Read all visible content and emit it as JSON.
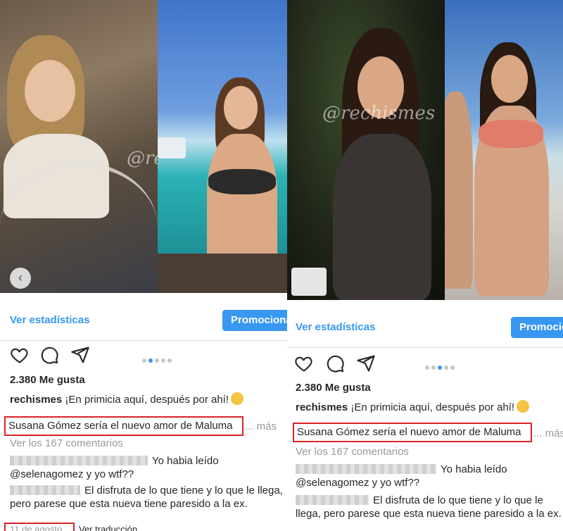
{
  "posts": [
    {
      "stats_link": "Ver estadísticas",
      "promo_label": "Promociona",
      "likes": "2.380 Me gusta",
      "username": "rechismes",
      "caption": "¡En primicia aquí, después por ahí!",
      "highlight": "Susana Gómez sería el nuevo amor de Maluma",
      "more": "... más",
      "view_comments": "Ver los 167 comentarios",
      "comments": [
        {
          "text_1": "Yo habia leído",
          "mention": "@selenagomez",
          "text_2": "y yo wtf??"
        },
        {
          "text": "El disfruta de lo que tiene y lo que le llega, pero parese que esta nueva tiene paresido a la ex."
        }
      ],
      "timestamp": "11 de agosto",
      "translate": "Ver traducción",
      "watermark": "@rechismes",
      "carousel_dots": 5,
      "active_dot": 1
    },
    {
      "stats_link": "Ver estadísticas",
      "promo_label": "Promocio",
      "likes": "2.380 Me gusta",
      "username": "rechismes",
      "caption": "¡En primicia aquí, después por ahí!",
      "highlight": "Susana Gómez sería el nuevo amor de Maluma",
      "more": "... más",
      "view_comments": "Ver los 167 comentarios",
      "comments": [
        {
          "text_1": "Yo habia leído",
          "mention": "@selenagomez",
          "text_2": "y yo wtf??"
        },
        {
          "text": "El disfruta de lo que tiene y lo que le llega, pero parese que esta nueva tiene paresido a la ex."
        }
      ],
      "watermark": "@rechismes",
      "carousel_dots": 5,
      "active_dot": 3
    }
  ],
  "colors": {
    "link_blue": "#3897f0",
    "highlight_red": "#d9232a",
    "muted_gray": "#999999"
  },
  "icons": [
    "heart-icon",
    "comment-icon",
    "share-icon",
    "chevron-left-icon",
    "emoji-icon"
  ]
}
